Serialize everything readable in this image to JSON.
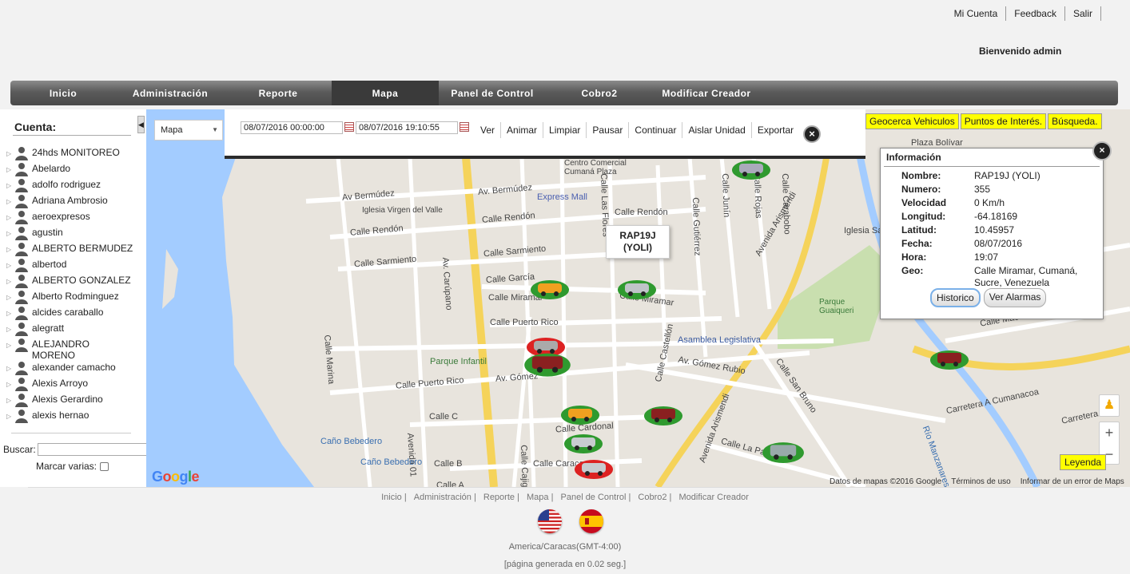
{
  "top_links": [
    "Mi Cuenta",
    "Feedback",
    "Salir"
  ],
  "welcome": "Bienvenido admin",
  "nav": [
    "Inicio",
    "Administración",
    "Reporte",
    "Mapa",
    "Panel de Control",
    "Cobro2",
    "Modificar Creador"
  ],
  "nav_active": "Mapa",
  "sidebar": {
    "title": "Cuenta:",
    "accounts": [
      "24hds MONITOREO",
      "Abelardo",
      "adolfo rodriguez",
      "Adriana Ambrosio",
      "aeroexpresos",
      "agustin",
      "ALBERTO BERMUDEZ",
      "albertod",
      "ALBERTO GONZALEZ",
      "Alberto Rodminguez",
      "alcides caraballo",
      "alegratt",
      "ALEJANDRO MORENO",
      "alexander camacho",
      "Alexis Arroyo",
      "Alexis Gerardino",
      "alexis hernao"
    ],
    "search_label": "Buscar:",
    "search_value": "",
    "multi_label": "Marcar varias:"
  },
  "map": {
    "type_select": "Mapa",
    "date_from": "08/07/2016 00:00:00",
    "date_to": "08/07/2016 19:10:55",
    "actions": [
      "Ver",
      "Animar",
      "Limpiar",
      "Pausar",
      "Continuar",
      "Aislar Unidad",
      "Exportar"
    ],
    "right_buttons": [
      "Geocerca Vehiculos",
      "Puntos de Interés.",
      "Búsqueda."
    ],
    "vehicle_label": "RAP19J\n(YOLI)",
    "leyenda": "Leyenda",
    "google": "Google",
    "attribution": [
      "Datos de mapas ©2016 Google",
      "Términos de uso",
      "Informar de un error de Maps"
    ],
    "street_labels": [
      "Av. Bermúdez",
      "Av Bermúdez",
      "Iglesia Virgen del Valle",
      "Calle Rendón",
      "Calle Rendón",
      "Calle Rendón",
      "Calle Sarmiento",
      "Calle Sarmiento",
      "Calle García",
      "Calle Miramar",
      "Calle Miramar",
      "Calle Puerto Rico",
      "Calle Puerto Rico",
      "Parque Infantil",
      "Av. Gómez Rubio",
      "Av. Gómez",
      "Calle C",
      "Calle Cardonal",
      "Calle B",
      "Calle Caracas",
      "Calle A",
      "Av. Carúpano",
      "Calle Marina",
      "Avenida 01",
      "Caño Bebedero",
      "Caño Bebedero",
      "Centro Comercial Cumaná Plaza",
      "Express Mall",
      "Asamblea Legislativa",
      "Parque Guaiqueri",
      "Avenida Arismendi",
      "Avenida Arismendi",
      "Calle San Bruno",
      "Calle La Pascua",
      "Plaza Bolívar",
      "Carretera A Cumanacoa",
      "Carretera",
      "Río Manzanares",
      "Iglesia Sa",
      "Calle Castellón",
      "Calle Gutiérrez",
      "Calle Junín",
      "Calle Rojas",
      "Calle Carabobo",
      "Calle Las Flores",
      "Calle Cajigal",
      "Calle Maca"
    ]
  },
  "info_panel": {
    "title": "Información",
    "rows": [
      {
        "k": "Nombre:",
        "v": "RAP19J (YOLI)"
      },
      {
        "k": "Numero:",
        "v": "355"
      },
      {
        "k": "Velocidad",
        "v": "0 Km/h"
      },
      {
        "k": "Longitud:",
        "v": "-64.18169"
      },
      {
        "k": "Latitud:",
        "v": "10.45957"
      },
      {
        "k": "Fecha:",
        "v": "08/07/2016"
      },
      {
        "k": "Hora:",
        "v": "19:07"
      },
      {
        "k": "Geo:",
        "v": "Calle Miramar, Cumaná, Sucre, Venezuela"
      }
    ],
    "btn_historico": "Historico",
    "btn_alarmas": "Ver Alarmas"
  },
  "footer": {
    "nav": [
      "Inicio |",
      "Administración |",
      "Reporte |",
      "Mapa |",
      "Panel de Control |",
      "Cobro2 |",
      "Modificar Creador"
    ],
    "timezone": "America/Caracas(GMT-4:00)",
    "generated": "[página generada en 0.02 seg.]"
  },
  "colors": {
    "nav_bg": "#5b5b5b",
    "highlight": "#ffff00",
    "water": "#a3ccff",
    "park": "#c9dfaf",
    "major_road": "#f5d35a"
  }
}
